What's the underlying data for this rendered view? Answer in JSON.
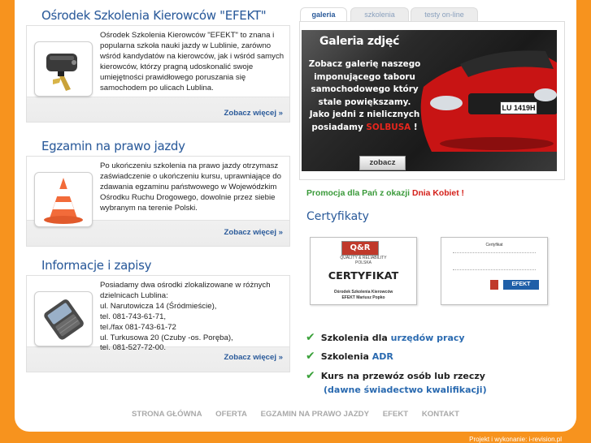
{
  "sections": [
    {
      "title": "Ośrodek Szkolenia Kierowców \"EFEKT\"",
      "text": "Ośrodek Szkolenia Kierowców \"EFEKT\" to znana i popularna szkoła nauki jazdy w Lublinie, zarówno wśród kandydatów na kierowców, jak i wśród samych kierowców, którzy pragną udoskonalić swoje umiejętności prawidłowego poruszania się samochodem po ulicach Lublina.",
      "more": "Zobacz więcej »",
      "icon": "car-keys-icon"
    },
    {
      "title": "Egzamin na prawo jazdy",
      "text": "Po ukończeniu szkolenia na prawo jazdy otrzymasz zaświadczenie o ukończeniu kursu, uprawniające do zdawania egzaminu państwowego w Wojewódzkim Ośrodku Ruchu Drogowego, dowolnie przez siebie wybranym na terenie Polski.",
      "more": "Zobacz więcej »",
      "icon": "traffic-cone-icon"
    },
    {
      "title": "Informacje i zapisy",
      "lines": [
        "Posiadamy dwa ośrodki zlokalizowane w różnych dzielnicach Lublina:",
        "ul. Narutowicza 14 (Śródmieście),",
        "tel. 081-743-61-71,",
        "tel./fax 081-743-61-72",
        "ul. Turkusowa 20 (Czuby -os. Poręba),",
        "tel. 081-527-72-00."
      ],
      "more": "Zobacz więcej »",
      "icon": "mobile-phone-icon"
    }
  ],
  "tabs": [
    "galeria",
    "szkolenia",
    "testy on-line"
  ],
  "active_tab": "galeria",
  "gallery": {
    "title": "Galeria zdjęć",
    "line1": "Zobacz galerię naszego",
    "line2": "imponującego taboru",
    "line3": "samochodowego który",
    "line4": "stale powiększamy.",
    "line5": "Jako jedni z nielicznych",
    "line6_prefix": "posiadamy ",
    "brand": "SOLBUSA",
    "line6_suffix": " !",
    "plate": "LU 1419H",
    "button": "zobacz"
  },
  "promo": {
    "prefix": "Promocja dla Pań z okazji ",
    "highlight": "Dnia Kobiet !"
  },
  "certificates": {
    "title": "Certyfikaty",
    "cert1_badge": "Q&R",
    "cert1_badge_sub": "QUALITY & RELIABILITY",
    "cert1_country": "POLSKA",
    "cert1_title": "CERTYFIKAT",
    "cert1_org": "Ośrodek Szkolenia Kierowców",
    "cert1_name": "EFEKT Mariusz Popko",
    "cert2_title": "Certyfikat",
    "cert2_logo": "EFEKT"
  },
  "offers": [
    {
      "prefix": "Szkolenia dla ",
      "highlight": "urzędów pracy"
    },
    {
      "prefix": "Szkolenia ",
      "highlight": "ADR"
    },
    {
      "prefix": "Kurs na przewóz osób lub rzeczy",
      "highlight": ""
    },
    {
      "prefix": "",
      "highlight": "(dawne świadectwo kwalifikacji)"
    }
  ],
  "footer_nav": [
    "STRONA GŁÓWNA",
    "OFERTA",
    "EGZAMIN NA PRAWO JAZDY",
    "EFEKT",
    "KONTAKT"
  ],
  "credit": "Projekt i wykonanie: i-revision.pl",
  "colors": {
    "background": "#f7931e",
    "heading": "#2a5a9a",
    "promo_green": "#3a9a3a",
    "promo_red": "#d4201a",
    "check_green": "#3aa13a"
  }
}
